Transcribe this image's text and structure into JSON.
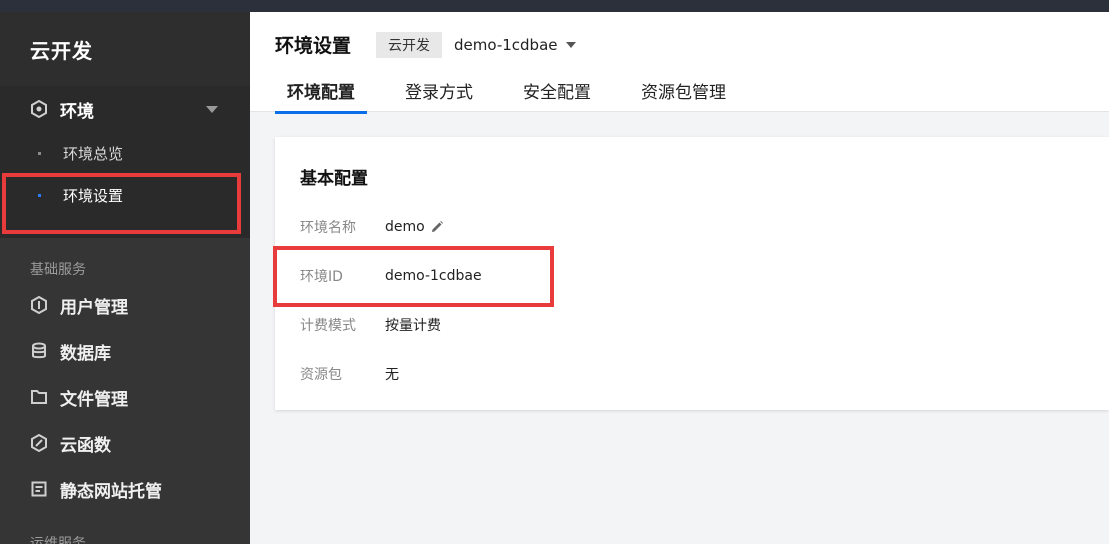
{
  "sidebar": {
    "brand": "云开发",
    "env_group": {
      "label": "环境",
      "icon": "hexagon-icon",
      "children": [
        {
          "label": "环境总览",
          "active": false
        },
        {
          "label": "环境设置",
          "active": true
        }
      ]
    },
    "section_basic": "基础服务",
    "items": [
      {
        "label": "用户管理",
        "icon": "user-shield-icon"
      },
      {
        "label": "数据库",
        "icon": "database-icon"
      },
      {
        "label": "文件管理",
        "icon": "folder-icon"
      },
      {
        "label": "云函数",
        "icon": "function-icon"
      },
      {
        "label": "静态网站托管",
        "icon": "webpage-icon"
      }
    ],
    "section_ops": "运维服务"
  },
  "header": {
    "title": "环境设置",
    "env_badge": "云开发",
    "env_id": "demo-1cdbae",
    "tabs": [
      {
        "label": "环境配置",
        "active": true
      },
      {
        "label": "登录方式",
        "active": false
      },
      {
        "label": "安全配置",
        "active": false
      },
      {
        "label": "资源包管理",
        "active": false
      }
    ]
  },
  "card": {
    "title": "基本配置",
    "fields": [
      {
        "key": "环境名称",
        "value": "demo",
        "editable": true
      },
      {
        "key": "环境ID",
        "value": "demo-1cdbae"
      },
      {
        "key": "计费模式",
        "value": "按量计费"
      },
      {
        "key": "资源包",
        "value": "无"
      }
    ]
  },
  "colors": {
    "sidebar_bg": "#353535",
    "accent": "#0a6ee8",
    "highlight": "#e83b3b"
  }
}
